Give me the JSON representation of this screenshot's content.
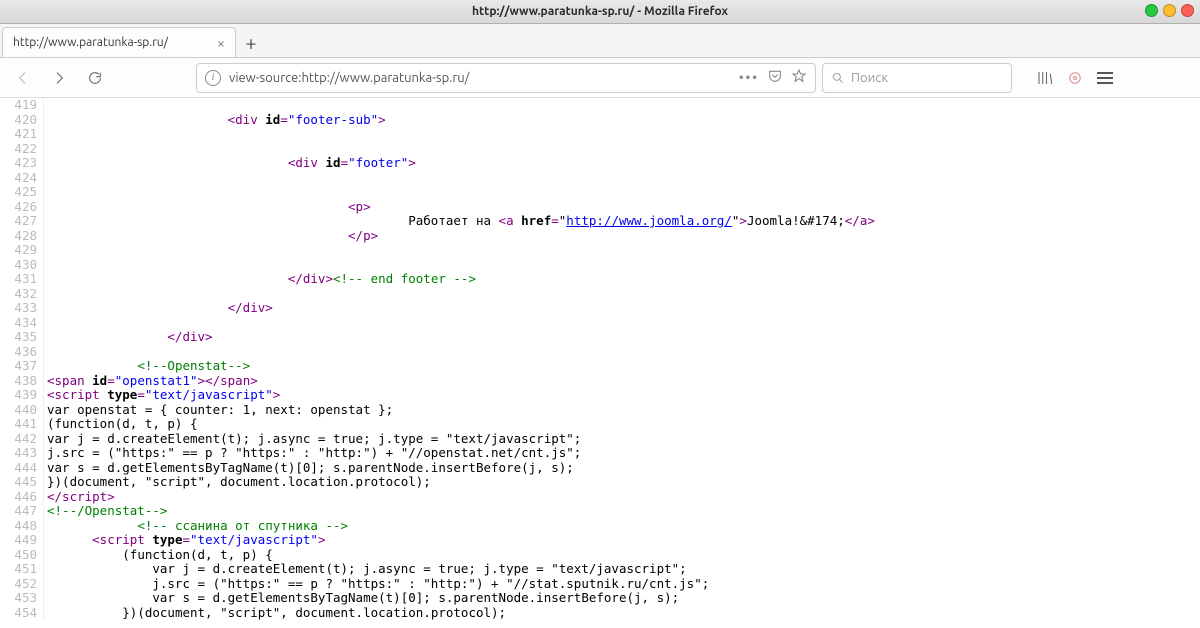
{
  "window": {
    "title": "http://www.paratunka-sp.ru/ - Mozilla Firefox"
  },
  "tab": {
    "label": "http://www.paratunka-sp.ru/"
  },
  "urlbar": {
    "text": "view-source:http://www.paratunka-sp.ru/"
  },
  "search": {
    "placeholder": "Поиск"
  },
  "src": {
    "start": 419,
    "end": 454,
    "link_href": "http://www.joomla.org/",
    "link_text": "Joomla!&#174;",
    "runs_on": "Работает на",
    "comments": {
      "end_footer": "<!-- end footer -->",
      "openstat_open": "<!--Openstat-->",
      "openstat_close": "<!--/Openstat-->",
      "sputnik": "<!-- ссанина от спутника -->"
    }
  }
}
